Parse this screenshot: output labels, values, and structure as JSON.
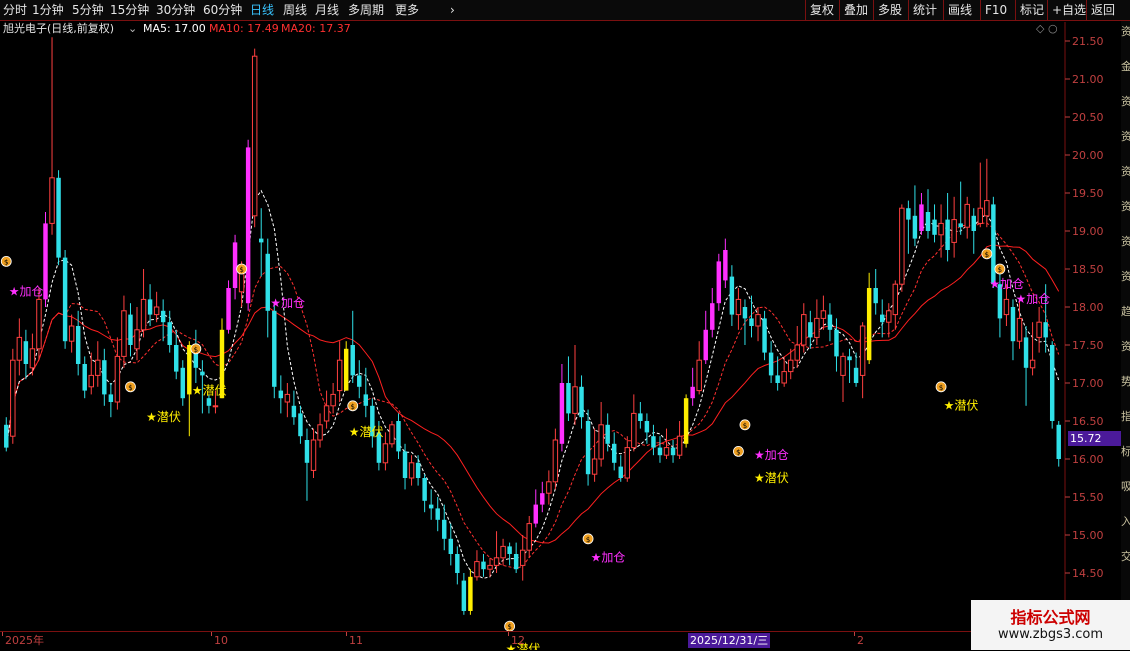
{
  "toolbar": {
    "left_items": [
      {
        "label": "分时",
        "x": 3
      },
      {
        "label": "1分钟",
        "x": 32
      },
      {
        "label": "5分钟",
        "x": 72
      },
      {
        "label": "15分钟",
        "x": 110
      },
      {
        "label": "30分钟",
        "x": 156
      },
      {
        "label": "60分钟",
        "x": 203
      },
      {
        "label": "日线",
        "x": 250,
        "active": true
      },
      {
        "label": "周线",
        "x": 283
      },
      {
        "label": "月线",
        "x": 315
      },
      {
        "label": "多周期",
        "x": 348
      },
      {
        "label": "更多",
        "x": 395
      }
    ],
    "right_items": [
      {
        "label": "复权",
        "x": 810
      },
      {
        "label": "叠加",
        "x": 844
      },
      {
        "label": "多股",
        "x": 878
      },
      {
        "label": "统计",
        "x": 913
      },
      {
        "label": "画线",
        "x": 948
      },
      {
        "label": "F10",
        "x": 985
      },
      {
        "label": "标记",
        "x": 1020
      },
      {
        "label": "+自选",
        "x": 1052
      },
      {
        "label": "返回",
        "x": 1091
      }
    ],
    "more_icon": "chevron-right-icon"
  },
  "infobar": {
    "stock": "旭光电子(日线,前复权)",
    "ma5": "MA5: 17.00",
    "ma10": "MA10: 17.49",
    "ma20": "MA20: 17.37",
    "ma5_color": "#ffffff",
    "ma10_color": "#ff3030",
    "ma20_color": "#ff3030"
  },
  "price_box": "15.72",
  "right_strip_chars": [
    "资",
    "金",
    "资",
    "资",
    "资",
    "资",
    "资",
    "资",
    "趋",
    "资",
    "势",
    "指",
    "标",
    "吸",
    "入",
    "交"
  ],
  "watermark": {
    "title": "指标公式网",
    "url": "www.zbgs3.com"
  },
  "datebar": {
    "labels": [
      {
        "text": "2025年",
        "x": 5
      },
      {
        "text": "10",
        "x": 214
      },
      {
        "text": "11",
        "x": 349
      },
      {
        "text": "12",
        "x": 511
      },
      {
        "text": "2",
        "x": 857
      }
    ],
    "highlight": {
      "text": "2025/12/31/三",
      "x": 688
    }
  },
  "chart_data": {
    "type": "candlestick",
    "ylim": [
      13.75,
      21.75
    ],
    "y_ticks": [
      14.0,
      14.5,
      15.0,
      15.5,
      16.0,
      16.5,
      17.0,
      17.5,
      18.0,
      18.5,
      19.0,
      19.5,
      20.0,
      20.5,
      21.0,
      21.5
    ],
    "colors": {
      "up": "#ff4040",
      "down": "#30e0e8",
      "signal_buy": "#ffee00",
      "signal_strong": "#ff30ff",
      "ma5": "#ffffff",
      "ma10": "#ff3030",
      "ma20": "#ff2020"
    },
    "candles": [
      [
        16.45,
        16.15,
        16.55,
        16.1,
        0
      ],
      [
        16.3,
        17.3,
        17.45,
        16.2,
        0
      ],
      [
        17.3,
        17.6,
        17.85,
        17.1,
        0
      ],
      [
        17.55,
        17.25,
        17.7,
        17.05,
        0
      ],
      [
        17.2,
        17.45,
        17.65,
        17.1,
        0
      ],
      [
        17.45,
        18.1,
        18.25,
        17.3,
        0
      ],
      [
        18.1,
        19.1,
        19.25,
        18.0,
        2
      ],
      [
        19.1,
        19.7,
        21.55,
        18.95,
        0
      ],
      [
        19.7,
        18.65,
        19.8,
        18.55,
        0
      ],
      [
        18.65,
        17.55,
        18.75,
        17.45,
        0
      ],
      [
        17.55,
        17.75,
        17.9,
        17.4,
        0
      ],
      [
        17.75,
        17.25,
        17.95,
        17.1,
        0
      ],
      [
        17.25,
        16.9,
        17.35,
        16.8,
        0
      ],
      [
        16.95,
        17.1,
        17.4,
        16.85,
        0
      ],
      [
        17.1,
        17.3,
        17.55,
        16.95,
        0
      ],
      [
        17.3,
        16.85,
        17.45,
        16.7,
        0
      ],
      [
        16.85,
        16.75,
        17.0,
        16.55,
        0
      ],
      [
        16.75,
        17.35,
        17.6,
        16.65,
        0
      ],
      [
        17.35,
        17.95,
        18.15,
        17.2,
        0
      ],
      [
        17.9,
        17.5,
        18.05,
        17.35,
        0
      ],
      [
        17.45,
        17.7,
        18.0,
        17.3,
        0
      ],
      [
        17.7,
        18.1,
        18.5,
        17.6,
        0
      ],
      [
        18.1,
        17.9,
        18.3,
        17.75,
        0
      ],
      [
        17.9,
        18.0,
        18.2,
        17.8,
        0
      ],
      [
        17.95,
        17.8,
        18.1,
        17.55,
        0
      ],
      [
        17.8,
        17.5,
        17.95,
        17.4,
        0
      ],
      [
        17.5,
        17.15,
        17.7,
        17.05,
        0
      ],
      [
        17.2,
        16.8,
        17.3,
        16.7,
        0
      ],
      [
        16.85,
        17.5,
        17.55,
        16.3,
        1
      ],
      [
        17.5,
        17.2,
        17.7,
        17.0,
        0
      ],
      [
        17.15,
        17.1,
        17.3,
        16.6,
        0
      ],
      [
        16.8,
        16.7,
        16.85,
        16.6,
        0
      ],
      [
        16.7,
        16.7,
        16.9,
        16.6,
        0
      ],
      [
        16.8,
        17.7,
        17.85,
        16.8,
        1
      ],
      [
        17.7,
        18.25,
        18.35,
        17.65,
        2
      ],
      [
        18.25,
        18.85,
        18.95,
        18.1,
        2
      ],
      [
        18.2,
        18.55,
        18.6,
        18.0,
        0
      ],
      [
        18.05,
        20.1,
        20.2,
        17.95,
        2
      ],
      [
        19.2,
        21.3,
        21.4,
        19.05,
        0
      ],
      [
        18.9,
        18.85,
        19.3,
        18.4,
        0
      ],
      [
        18.7,
        17.95,
        18.9,
        17.6,
        0
      ],
      [
        17.95,
        16.95,
        18.05,
        16.8,
        0
      ],
      [
        16.9,
        16.8,
        17.1,
        16.6,
        0
      ],
      [
        16.75,
        16.85,
        17.0,
        16.55,
        0
      ],
      [
        16.7,
        16.55,
        16.9,
        16.45,
        0
      ],
      [
        16.6,
        16.3,
        16.7,
        16.2,
        0
      ],
      [
        16.25,
        15.95,
        16.4,
        15.45,
        0
      ],
      [
        15.85,
        16.25,
        16.4,
        15.75,
        0
      ],
      [
        16.25,
        16.45,
        16.6,
        16.15,
        0
      ],
      [
        16.5,
        16.7,
        16.9,
        16.4,
        0
      ],
      [
        16.7,
        16.85,
        17.0,
        16.6,
        0
      ],
      [
        16.9,
        17.3,
        17.55,
        16.75,
        0
      ],
      [
        16.9,
        17.45,
        17.55,
        16.9,
        1
      ],
      [
        17.5,
        17.1,
        17.95,
        17.0,
        0
      ],
      [
        17.1,
        16.95,
        17.3,
        16.8,
        0
      ],
      [
        16.85,
        16.7,
        17.2,
        16.55,
        0
      ],
      [
        16.7,
        16.3,
        16.8,
        16.15,
        0
      ],
      [
        16.35,
        15.95,
        16.5,
        15.85,
        0
      ],
      [
        15.95,
        16.2,
        16.35,
        15.85,
        0
      ],
      [
        16.2,
        16.45,
        16.5,
        16.15,
        0
      ],
      [
        16.5,
        16.1,
        16.6,
        16.0,
        0
      ],
      [
        16.1,
        15.75,
        16.2,
        15.6,
        0
      ],
      [
        15.75,
        15.95,
        16.05,
        15.65,
        0
      ],
      [
        15.95,
        15.75,
        16.05,
        15.65,
        0
      ],
      [
        15.75,
        15.45,
        15.8,
        15.3,
        0
      ],
      [
        15.4,
        15.35,
        15.6,
        15.2,
        0
      ],
      [
        15.35,
        15.2,
        15.5,
        15.05,
        0
      ],
      [
        15.2,
        14.95,
        15.4,
        14.8,
        0
      ],
      [
        14.95,
        14.75,
        15.15,
        14.6,
        0
      ],
      [
        14.75,
        14.5,
        14.85,
        14.35,
        0
      ],
      [
        14.4,
        14.0,
        14.5,
        13.95,
        0
      ],
      [
        14.0,
        14.45,
        14.55,
        13.95,
        1
      ],
      [
        14.45,
        14.65,
        14.8,
        14.4,
        0
      ],
      [
        14.65,
        14.55,
        14.75,
        14.45,
        0
      ],
      [
        14.55,
        14.6,
        14.7,
        14.45,
        0
      ],
      [
        14.6,
        14.7,
        15.05,
        14.5,
        0
      ],
      [
        14.7,
        14.85,
        14.95,
        14.6,
        0
      ],
      [
        14.85,
        14.75,
        14.9,
        14.6,
        0
      ],
      [
        14.75,
        14.55,
        14.9,
        14.5,
        0
      ],
      [
        14.6,
        14.8,
        15.0,
        14.4,
        0
      ],
      [
        14.8,
        15.15,
        15.25,
        14.7,
        0
      ],
      [
        15.15,
        15.4,
        15.6,
        15.1,
        2
      ],
      [
        15.4,
        15.55,
        15.7,
        15.3,
        2
      ],
      [
        15.55,
        15.7,
        15.85,
        15.4,
        0
      ],
      [
        15.7,
        16.25,
        16.4,
        15.6,
        0
      ],
      [
        16.2,
        17.0,
        17.25,
        16.1,
        2
      ],
      [
        17.0,
        16.6,
        17.35,
        16.5,
        0
      ],
      [
        16.6,
        16.95,
        17.5,
        16.45,
        0
      ],
      [
        16.95,
        16.55,
        17.1,
        16.4,
        0
      ],
      [
        16.5,
        15.8,
        16.65,
        15.65,
        0
      ],
      [
        15.8,
        16.0,
        16.4,
        15.7,
        0
      ],
      [
        16.0,
        16.45,
        16.75,
        15.9,
        0
      ],
      [
        16.45,
        16.2,
        16.6,
        16.1,
        0
      ],
      [
        16.2,
        15.95,
        16.35,
        15.85,
        0
      ],
      [
        15.9,
        15.75,
        16.05,
        15.7,
        0
      ],
      [
        15.75,
        16.15,
        16.3,
        15.7,
        0
      ],
      [
        16.15,
        16.6,
        16.85,
        16.1,
        0
      ],
      [
        16.6,
        16.5,
        16.75,
        16.4,
        0
      ],
      [
        16.5,
        16.35,
        16.6,
        16.2,
        0
      ],
      [
        16.3,
        16.15,
        16.45,
        16.05,
        0
      ],
      [
        16.15,
        16.05,
        16.3,
        15.95,
        0
      ],
      [
        16.05,
        16.15,
        16.4,
        16.0,
        0
      ],
      [
        16.15,
        16.05,
        16.25,
        15.95,
        0
      ],
      [
        16.05,
        16.3,
        16.5,
        16.0,
        0
      ],
      [
        16.2,
        16.8,
        16.85,
        16.15,
        1
      ],
      [
        16.8,
        16.95,
        17.2,
        16.7,
        2
      ],
      [
        16.9,
        17.3,
        17.55,
        16.85,
        0
      ],
      [
        17.3,
        17.7,
        17.95,
        17.25,
        2
      ],
      [
        17.7,
        18.05,
        18.25,
        17.6,
        2
      ],
      [
        18.05,
        18.6,
        18.7,
        17.95,
        2
      ],
      [
        18.35,
        18.75,
        18.9,
        18.25,
        2
      ],
      [
        18.4,
        17.9,
        18.55,
        17.75,
        0
      ],
      [
        17.9,
        18.1,
        18.25,
        17.7,
        0
      ],
      [
        18.0,
        17.85,
        18.1,
        17.5,
        0
      ],
      [
        17.85,
        17.75,
        18.15,
        17.6,
        0
      ],
      [
        17.75,
        17.9,
        18.0,
        17.55,
        0
      ],
      [
        17.85,
        17.4,
        17.95,
        17.3,
        0
      ],
      [
        17.4,
        17.1,
        17.55,
        17.0,
        0
      ],
      [
        17.1,
        17.0,
        17.35,
        16.9,
        0
      ],
      [
        17.0,
        17.15,
        17.35,
        16.95,
        0
      ],
      [
        17.15,
        17.3,
        17.45,
        17.05,
        0
      ],
      [
        17.3,
        17.5,
        17.75,
        17.2,
        0
      ],
      [
        17.5,
        17.9,
        18.05,
        17.4,
        0
      ],
      [
        17.8,
        17.6,
        17.95,
        17.45,
        0
      ],
      [
        17.6,
        17.85,
        18.1,
        17.5,
        0
      ],
      [
        17.85,
        17.95,
        18.15,
        17.7,
        0
      ],
      [
        17.9,
        17.7,
        18.05,
        17.55,
        0
      ],
      [
        17.7,
        17.35,
        17.85,
        17.15,
        0
      ],
      [
        17.1,
        17.35,
        17.4,
        16.75,
        0
      ],
      [
        17.35,
        17.3,
        17.45,
        17.0,
        0
      ],
      [
        17.2,
        17.0,
        17.4,
        16.95,
        0
      ],
      [
        17.1,
        17.75,
        17.8,
        16.8,
        0
      ],
      [
        17.3,
        18.25,
        18.45,
        17.25,
        1
      ],
      [
        18.25,
        18.05,
        18.5,
        17.9,
        0
      ],
      [
        17.9,
        17.8,
        18.1,
        17.6,
        0
      ],
      [
        17.8,
        17.95,
        18.05,
        17.6,
        0
      ],
      [
        17.9,
        18.3,
        18.35,
        17.7,
        0
      ],
      [
        18.3,
        19.3,
        19.35,
        18.2,
        0
      ],
      [
        19.3,
        19.15,
        19.4,
        18.7,
        0
      ],
      [
        19.2,
        18.9,
        19.6,
        18.8,
        0
      ],
      [
        19.0,
        19.35,
        19.5,
        18.95,
        2
      ],
      [
        19.25,
        19.0,
        19.55,
        18.9,
        0
      ],
      [
        19.15,
        18.95,
        19.35,
        18.85,
        0
      ],
      [
        18.95,
        19.1,
        19.35,
        18.65,
        0
      ],
      [
        19.15,
        18.75,
        19.5,
        18.6,
        0
      ],
      [
        18.85,
        19.15,
        19.45,
        18.65,
        0
      ],
      [
        19.1,
        19.05,
        19.65,
        18.95,
        0
      ],
      [
        19.05,
        19.35,
        19.45,
        18.9,
        0
      ],
      [
        19.2,
        19.0,
        19.3,
        18.7,
        0
      ],
      [
        19.1,
        19.3,
        19.9,
        19.05,
        0
      ],
      [
        19.2,
        19.4,
        19.95,
        19.05,
        0
      ],
      [
        19.35,
        18.3,
        19.45,
        18.25,
        0
      ],
      [
        18.3,
        17.85,
        18.55,
        17.6,
        0
      ],
      [
        17.9,
        18.1,
        18.3,
        17.75,
        0
      ],
      [
        18.0,
        17.55,
        18.1,
        17.3,
        0
      ],
      [
        17.55,
        17.85,
        18.1,
        17.45,
        0
      ],
      [
        17.6,
        17.2,
        17.75,
        16.7,
        0
      ],
      [
        17.2,
        17.3,
        17.8,
        17.1,
        0
      ],
      [
        17.6,
        17.8,
        18.0,
        17.4,
        0
      ],
      [
        17.8,
        17.6,
        18.3,
        17.4,
        0
      ],
      [
        17.5,
        16.5,
        17.55,
        16.4,
        0
      ],
      [
        16.45,
        16.0,
        16.5,
        15.9,
        0
      ]
    ],
    "annotations": [
      {
        "type": "bag",
        "idx": 0,
        "price": 18.6
      },
      {
        "type": "add",
        "idx": 1,
        "price": 18.15,
        "text": "★加仓"
      },
      {
        "type": "bag",
        "idx": 19,
        "price": 16.95
      },
      {
        "type": "bag",
        "idx": 29,
        "price": 17.45
      },
      {
        "type": "hide",
        "idx": 22,
        "price": 16.5,
        "text": "★潜伏"
      },
      {
        "type": "hide",
        "idx": 29,
        "price": 16.85,
        "text": "★潜伏"
      },
      {
        "type": "bag",
        "idx": 36,
        "price": 18.5
      },
      {
        "type": "add",
        "idx": 41,
        "price": 18.0,
        "text": "★加仓"
      },
      {
        "type": "bag",
        "idx": 53,
        "price": 16.7
      },
      {
        "type": "hide",
        "idx": 53,
        "price": 16.3,
        "text": "★潜伏"
      },
      {
        "type": "bag",
        "idx": 77,
        "price": 13.8
      },
      {
        "type": "hide",
        "idx": 77,
        "price": 13.45,
        "text": "★潜伏"
      },
      {
        "type": "bag",
        "idx": 89,
        "price": 14.95
      },
      {
        "type": "add",
        "idx": 90,
        "price": 14.65,
        "text": "★加仓"
      },
      {
        "type": "bag",
        "idx": 112,
        "price": 16.1
      },
      {
        "type": "bag",
        "idx": 113,
        "price": 16.45
      },
      {
        "type": "add",
        "idx": 115,
        "price": 16.0,
        "text": "★加仓"
      },
      {
        "type": "hide",
        "idx": 115,
        "price": 15.7,
        "text": "★潜伏"
      },
      {
        "type": "bag",
        "idx": 143,
        "price": 16.95
      },
      {
        "type": "hide",
        "idx": 144,
        "price": 16.65,
        "text": "★潜伏"
      },
      {
        "type": "bag",
        "idx": 150,
        "price": 18.7
      },
      {
        "type": "bag",
        "idx": 152,
        "price": 18.5
      },
      {
        "type": "add",
        "idx": 151,
        "price": 18.25,
        "text": "★加仓"
      },
      {
        "type": "add",
        "idx": 155,
        "price": 18.05,
        "text": "★加仓"
      }
    ]
  }
}
